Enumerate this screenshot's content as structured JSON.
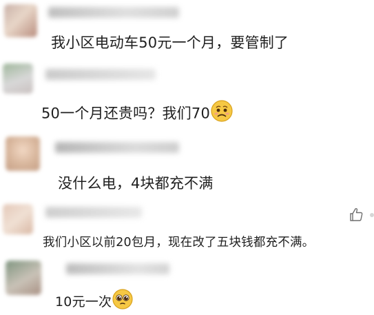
{
  "comments": [
    {
      "text": "我小区电动车50元一个月，要管制了"
    },
    {
      "text": "50一个月还贵吗？我们70",
      "emoji": "worried-face-emoji"
    },
    {
      "text": "没什么电，4块都充不满"
    },
    {
      "text": "我们小区以前20包月，现在改了五块钱都充不满。"
    },
    {
      "text": "10元一次",
      "emoji": "pleading-face-emoji"
    }
  ],
  "icons": {
    "like": "thumbs-up-icon"
  },
  "colors": {
    "text": "#1f1f1f",
    "blurred_meta": "#b9b9b9",
    "emoji_face": "#f5c343"
  }
}
